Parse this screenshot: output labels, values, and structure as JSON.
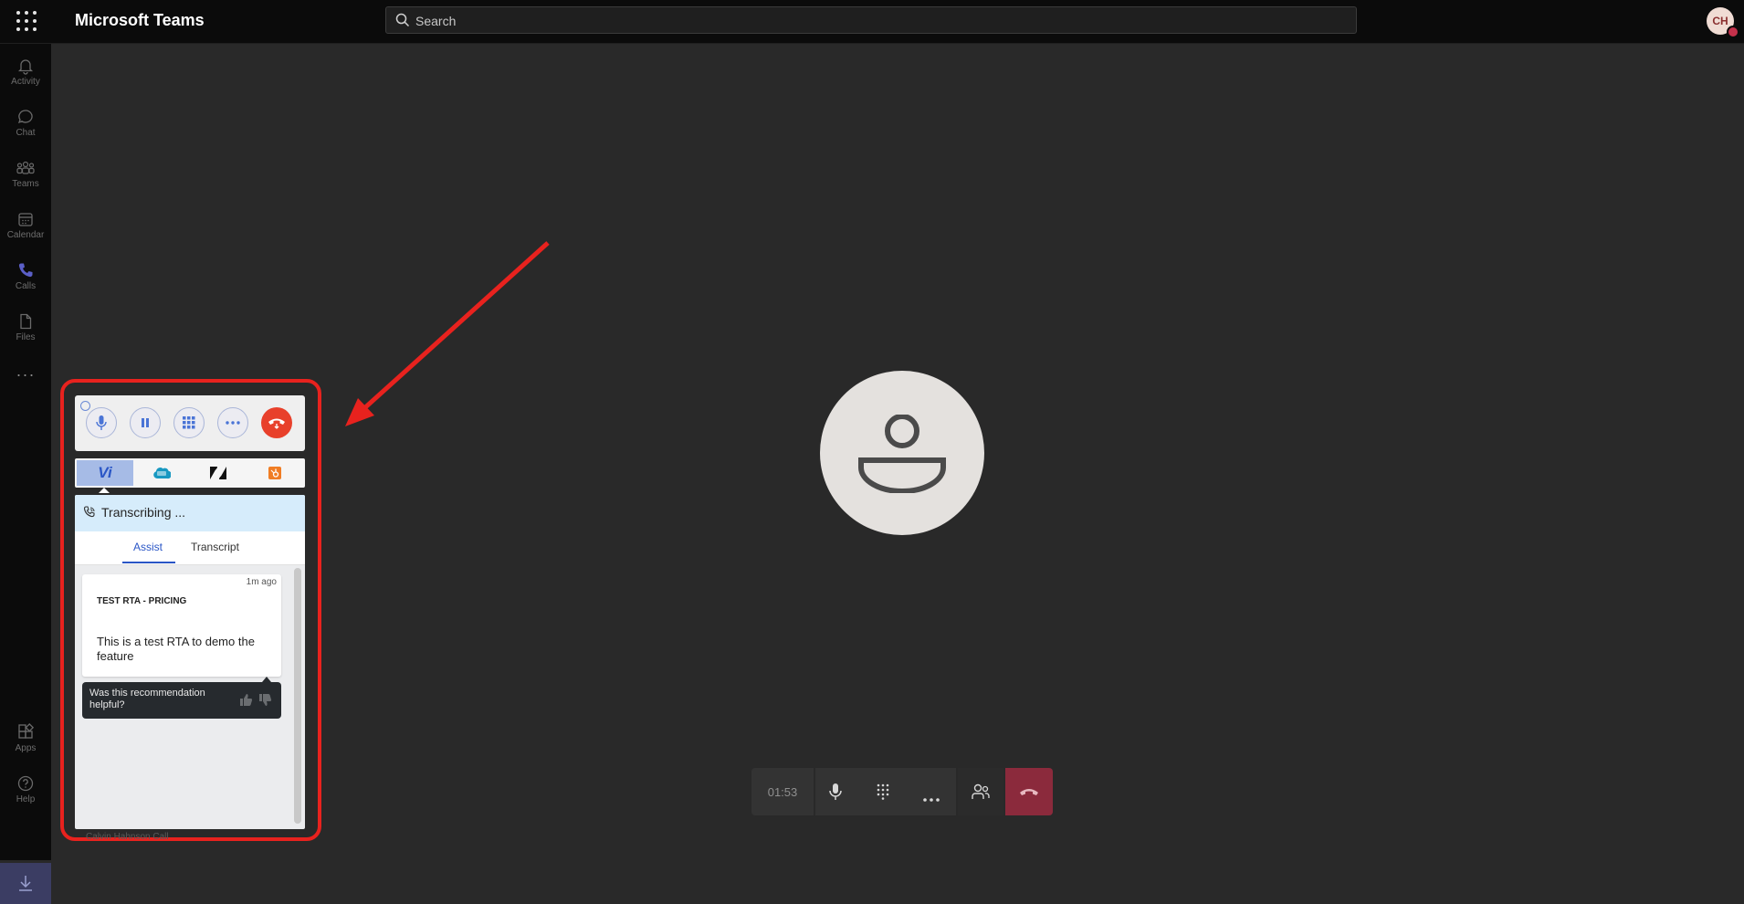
{
  "app": {
    "title": "Microsoft Teams",
    "user_initials": "CH"
  },
  "search": {
    "placeholder": "Search"
  },
  "rail": {
    "items": [
      {
        "label": "Activity",
        "icon": "bell-icon"
      },
      {
        "label": "Chat",
        "icon": "chat-icon"
      },
      {
        "label": "Teams",
        "icon": "teams-icon"
      },
      {
        "label": "Calendar",
        "icon": "calendar-icon"
      },
      {
        "label": "Calls",
        "icon": "phone-icon"
      },
      {
        "label": "Files",
        "icon": "file-icon"
      }
    ],
    "more": "···",
    "bottom": [
      {
        "label": "Apps",
        "icon": "apps-icon"
      },
      {
        "label": "Help",
        "icon": "help-icon"
      }
    ]
  },
  "widget": {
    "controls": [
      "mute",
      "hold",
      "keypad",
      "more",
      "hang-up"
    ],
    "integration_tabs": [
      {
        "label": "Vi",
        "active": true
      },
      {
        "label": "salesforce"
      },
      {
        "label": "zendesk"
      },
      {
        "label": "hubspot"
      }
    ],
    "status": "Transcribing ...",
    "sub_tabs": {
      "assist": "Assist",
      "transcript": "Transcript"
    },
    "card": {
      "time": "1m ago",
      "title": "TEST RTA - PRICING",
      "body": "This is a test RTA to demo the feature"
    },
    "feedback": "Was this recommendation helpful?",
    "footer_name": "Calvin Hahnson Call"
  },
  "callbar": {
    "timer": "01:53",
    "end_color": "#8b2a3c"
  },
  "colors": {
    "accent": "#2a56c6",
    "highlight": "#e8221e",
    "hangup": "#e8402b"
  }
}
